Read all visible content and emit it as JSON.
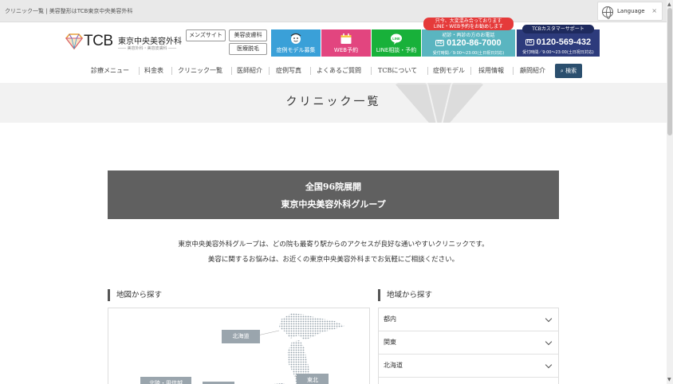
{
  "topbar": {
    "breadcrumb": "クリニック一覧 | 美容整形はTCB東京中央美容外科"
  },
  "language": {
    "label": "Language",
    "icon": "globe-icon",
    "close_icon": "close-icon"
  },
  "logo": {
    "brand": "TCB",
    "name": "東京中央美容外科",
    "sub": "―― 美容外科・美容皮膚科 ――"
  },
  "header_links": {
    "mens": "メンズサイト",
    "derm": "美容皮膚科",
    "hair": "医療脱毛"
  },
  "cta": {
    "case": {
      "label": "症例モデル募集",
      "icon": "face-icon",
      "color": "#3aa0d8"
    },
    "web": {
      "label": "WEB予約",
      "icon": "calendar-icon",
      "color": "#e2457f"
    },
    "line": {
      "label": "LINE相談・予約",
      "icon": "line-icon",
      "color": "#18b13a"
    }
  },
  "phone_main": {
    "bubble1": "只今、大変混み合っております",
    "bubble2": "LINE・WEB予約をお勧めします",
    "caption": "初診・再診の方のお電話",
    "number": "0120-86-7000",
    "hours": "受付時間／9:00〜23:00(土日祝日対応)",
    "color": "#5ab5c0"
  },
  "phone_support": {
    "badge": "TCBカスタマーサポート",
    "number": "0120-569-432",
    "hours": "受付時間／9:00〜23:00(土日祝日対応)",
    "color": "#2d3b7c"
  },
  "nav": {
    "items": [
      "診療メニュー",
      "料金表",
      "クリニック一覧",
      "医師紹介",
      "症例写真",
      "よくあるご質問",
      "TCBについて",
      "症例モデル",
      "採用情報",
      "顧問紹介"
    ],
    "search": "検索"
  },
  "hero": {
    "title": "クリニック一覧"
  },
  "banner": {
    "line1": "全国96院展開",
    "line2": "東京中央美容外科グループ"
  },
  "intro": {
    "line1": "東京中央美容外科グループは、どの院も最寄り駅からのアクセスが良好な通いやすいクリニックです。",
    "line2": "美容に関するお悩みは、お近くの東京中央美容外科までお気軽にご相談ください。"
  },
  "map_section": {
    "heading": "地図から探す",
    "labels": [
      "北海道",
      "東北",
      "北陸・甲信越",
      ""
    ]
  },
  "region_section": {
    "heading": "地域から探す",
    "items": [
      "都内",
      "関東",
      "北海道"
    ]
  }
}
